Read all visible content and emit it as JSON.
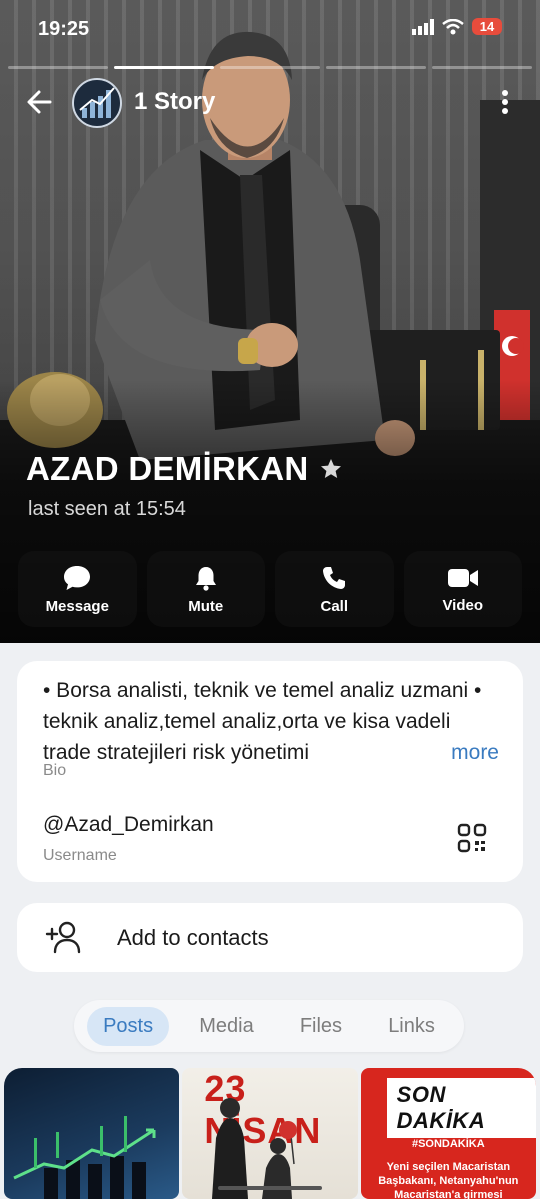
{
  "status_bar": {
    "time": "19:25",
    "battery": "14"
  },
  "header": {
    "story_label": "1 Story"
  },
  "profile": {
    "name": "AZAD DEMİRKAN",
    "last_seen": "last seen at 15:54"
  },
  "actions": [
    {
      "label": "Message",
      "icon": "chat-bubble-icon"
    },
    {
      "label": "Mute",
      "icon": "bell-icon"
    },
    {
      "label": "Call",
      "icon": "phone-icon"
    },
    {
      "label": "Video",
      "icon": "video-camera-icon"
    }
  ],
  "bio": {
    "text": " •  Borsa analisti, teknik ve temel analiz uzmani  •  teknik analiz,temel analiz,orta ve kisa vadeli trade stratejileri risk yönetimi",
    "more": "more",
    "label": "Bio"
  },
  "username": {
    "value": "@Azad_Demirkan",
    "label": "Username"
  },
  "contacts": {
    "label": "Add to contacts"
  },
  "tabs": [
    {
      "label": "Posts",
      "active": true
    },
    {
      "label": "Media",
      "active": false
    },
    {
      "label": "Files",
      "active": false
    },
    {
      "label": "Links",
      "active": false
    }
  ],
  "posts": {
    "post2_title": "23 NİSAN",
    "post3_badge": "SON DAKİKA",
    "post3_tag": "#SONDAKİKA",
    "post3_news": "Yeni seçilen Macaristan Başbakanı, Netanyahu'nun Macaristan'a girmesi"
  },
  "colors": {
    "accent": "#3a7bc0",
    "battery": "#e74c3c",
    "news_red": "#d7261e"
  }
}
